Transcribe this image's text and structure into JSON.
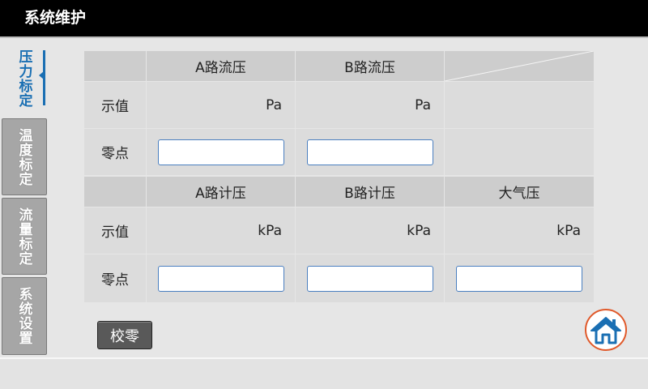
{
  "window": {
    "title": "系统维护"
  },
  "sidebar": {
    "tabs": [
      {
        "label": "压力标定",
        "active": true
      },
      {
        "label": "温度标定",
        "active": false
      },
      {
        "label": "流量标定",
        "active": false
      },
      {
        "label": "系统设置",
        "active": false
      }
    ]
  },
  "flow_pressure": {
    "headers": [
      "A路流压",
      "B路流压"
    ],
    "display_label": "示值",
    "zero_label": "零点",
    "units": [
      "Pa",
      "Pa"
    ],
    "inputs": [
      "",
      ""
    ]
  },
  "gauge_pressure": {
    "headers": [
      "A路计压",
      "B路计压",
      "大气压"
    ],
    "display_label": "示值",
    "zero_label": "零点",
    "units": [
      "kPa",
      "kPa",
      "kPa"
    ],
    "inputs": [
      "",
      "",
      ""
    ]
  },
  "actions": {
    "zero_button": "校零"
  },
  "icons": {
    "home": "home-icon"
  },
  "colors": {
    "accent": "#1a6fb3",
    "home_ring": "#e0592a",
    "title_bar": "#000000"
  }
}
